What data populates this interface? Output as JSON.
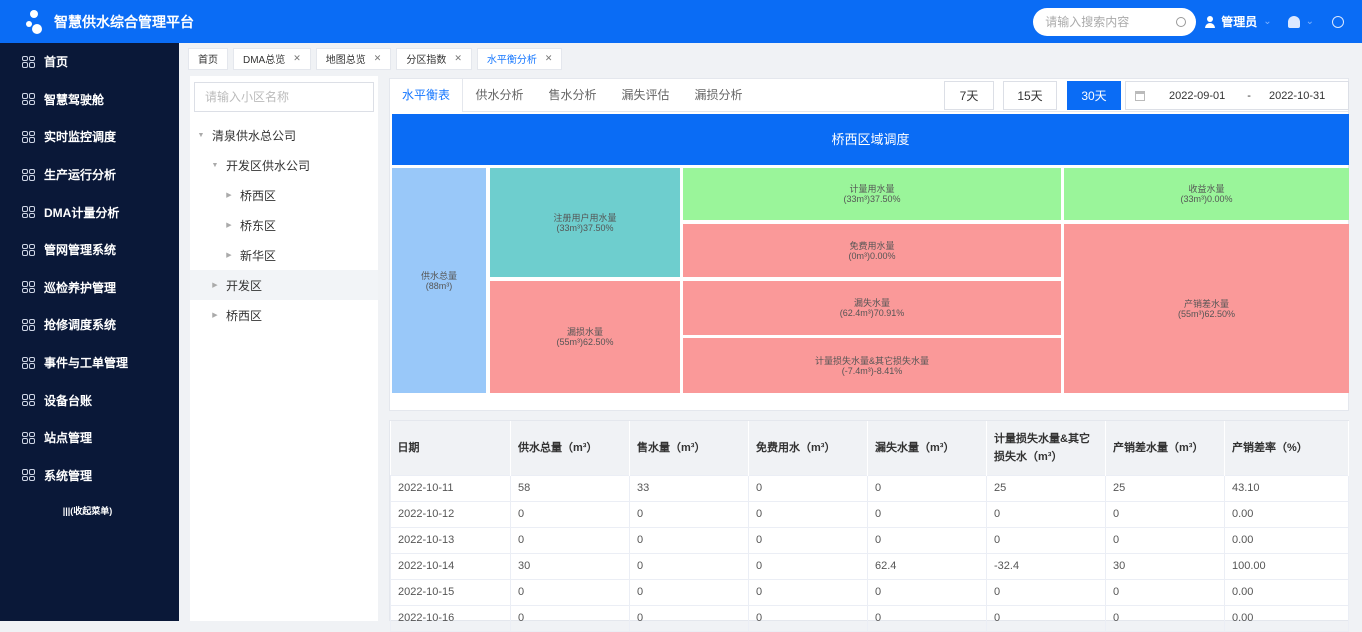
{
  "app": {
    "title": "智慧供水综合管理平台"
  },
  "header": {
    "search_placeholder": "请输入搜索内容",
    "user": "管理员"
  },
  "sidebar": {
    "items": [
      {
        "label": "首页"
      },
      {
        "label": "智慧驾驶舱"
      },
      {
        "label": "实时监控调度"
      },
      {
        "label": "生产运行分析"
      },
      {
        "label": "DMA计量分析"
      },
      {
        "label": "管网管理系统"
      },
      {
        "label": "巡检养护管理"
      },
      {
        "label": "抢修调度系统"
      },
      {
        "label": "事件与工单管理"
      },
      {
        "label": "设备台账"
      },
      {
        "label": "站点管理"
      },
      {
        "label": "系统管理"
      }
    ],
    "collapse_label": "|||(收起菜单)"
  },
  "tabs": [
    {
      "label": "首页",
      "closable": false
    },
    {
      "label": "DMA总览",
      "closable": true
    },
    {
      "label": "地图总览",
      "closable": true
    },
    {
      "label": "分区指数",
      "closable": true
    },
    {
      "label": "水平衡分析",
      "closable": true,
      "active": true
    }
  ],
  "tree": {
    "search_placeholder": "请输入小区名称",
    "nodes": [
      {
        "label": "清泉供水总公司"
      },
      {
        "label": "开发区供水公司"
      },
      {
        "label": "桥西区"
      },
      {
        "label": "桥东区"
      },
      {
        "label": "新华区"
      },
      {
        "label": "开发区"
      },
      {
        "label": "桥西区"
      }
    ]
  },
  "subtabs": [
    {
      "label": "水平衡表",
      "active": true
    },
    {
      "label": "供水分析"
    },
    {
      "label": "售水分析"
    },
    {
      "label": "漏失评估"
    },
    {
      "label": "漏损分析"
    }
  ],
  "ranges": [
    {
      "label": "7天"
    },
    {
      "label": "15天"
    },
    {
      "label": "30天",
      "active": true
    }
  ],
  "date_range": {
    "start": "2022-09-01",
    "sep": "-",
    "end": "2022-10-31"
  },
  "balance": {
    "title": "桥西区域调度",
    "supply": {
      "label": "供水总量",
      "value": "(88m³)"
    },
    "registered": {
      "label": "注册用户用水量",
      "value": "(33m³)37.50%"
    },
    "loss": {
      "label": "漏损水量",
      "value": "(55m³)62.50%"
    },
    "metered": {
      "label": "计量用水量",
      "value": "(33m³)37.50%"
    },
    "free": {
      "label": "免费用水量",
      "value": "(0m³)0.00%"
    },
    "leak": {
      "label": "漏失水量",
      "value": "(62.4m³)70.91%"
    },
    "metering_loss": {
      "label": "计量损失水量&其它损失水量",
      "value": "(-7.4m³)-8.41%"
    },
    "revenue": {
      "label": "收益水量",
      "value": "(33m³)0.00%"
    },
    "nrw": {
      "label": "产销差水量",
      "value": "(55m³)62.50%"
    },
    "colors": {
      "header": "#0a6cf5",
      "blue": "#99c8f9",
      "teal": "#6ecece",
      "red": "#fa9999",
      "green": "#9af59a"
    }
  },
  "table": {
    "columns": [
      "日期",
      "供水总量（m³）",
      "售水量（m³）",
      "免费用水（m³）",
      "漏失水量（m³）",
      "计量损失水量&其它损失水（m³）",
      "产销差水量（m³）",
      "产销差率（%）"
    ],
    "rows": [
      [
        "2022-10-11",
        "58",
        "33",
        "0",
        "0",
        "25",
        "25",
        "43.10"
      ],
      [
        "2022-10-12",
        "0",
        "0",
        "0",
        "0",
        "0",
        "0",
        "0.00"
      ],
      [
        "2022-10-13",
        "0",
        "0",
        "0",
        "0",
        "0",
        "0",
        "0.00"
      ],
      [
        "2022-10-14",
        "30",
        "0",
        "0",
        "62.4",
        "-32.4",
        "30",
        "100.00"
      ],
      [
        "2022-10-15",
        "0",
        "0",
        "0",
        "0",
        "0",
        "0",
        "0.00"
      ],
      [
        "2022-10-16",
        "0",
        "0",
        "0",
        "0",
        "0",
        "0",
        "0.00"
      ]
    ]
  }
}
